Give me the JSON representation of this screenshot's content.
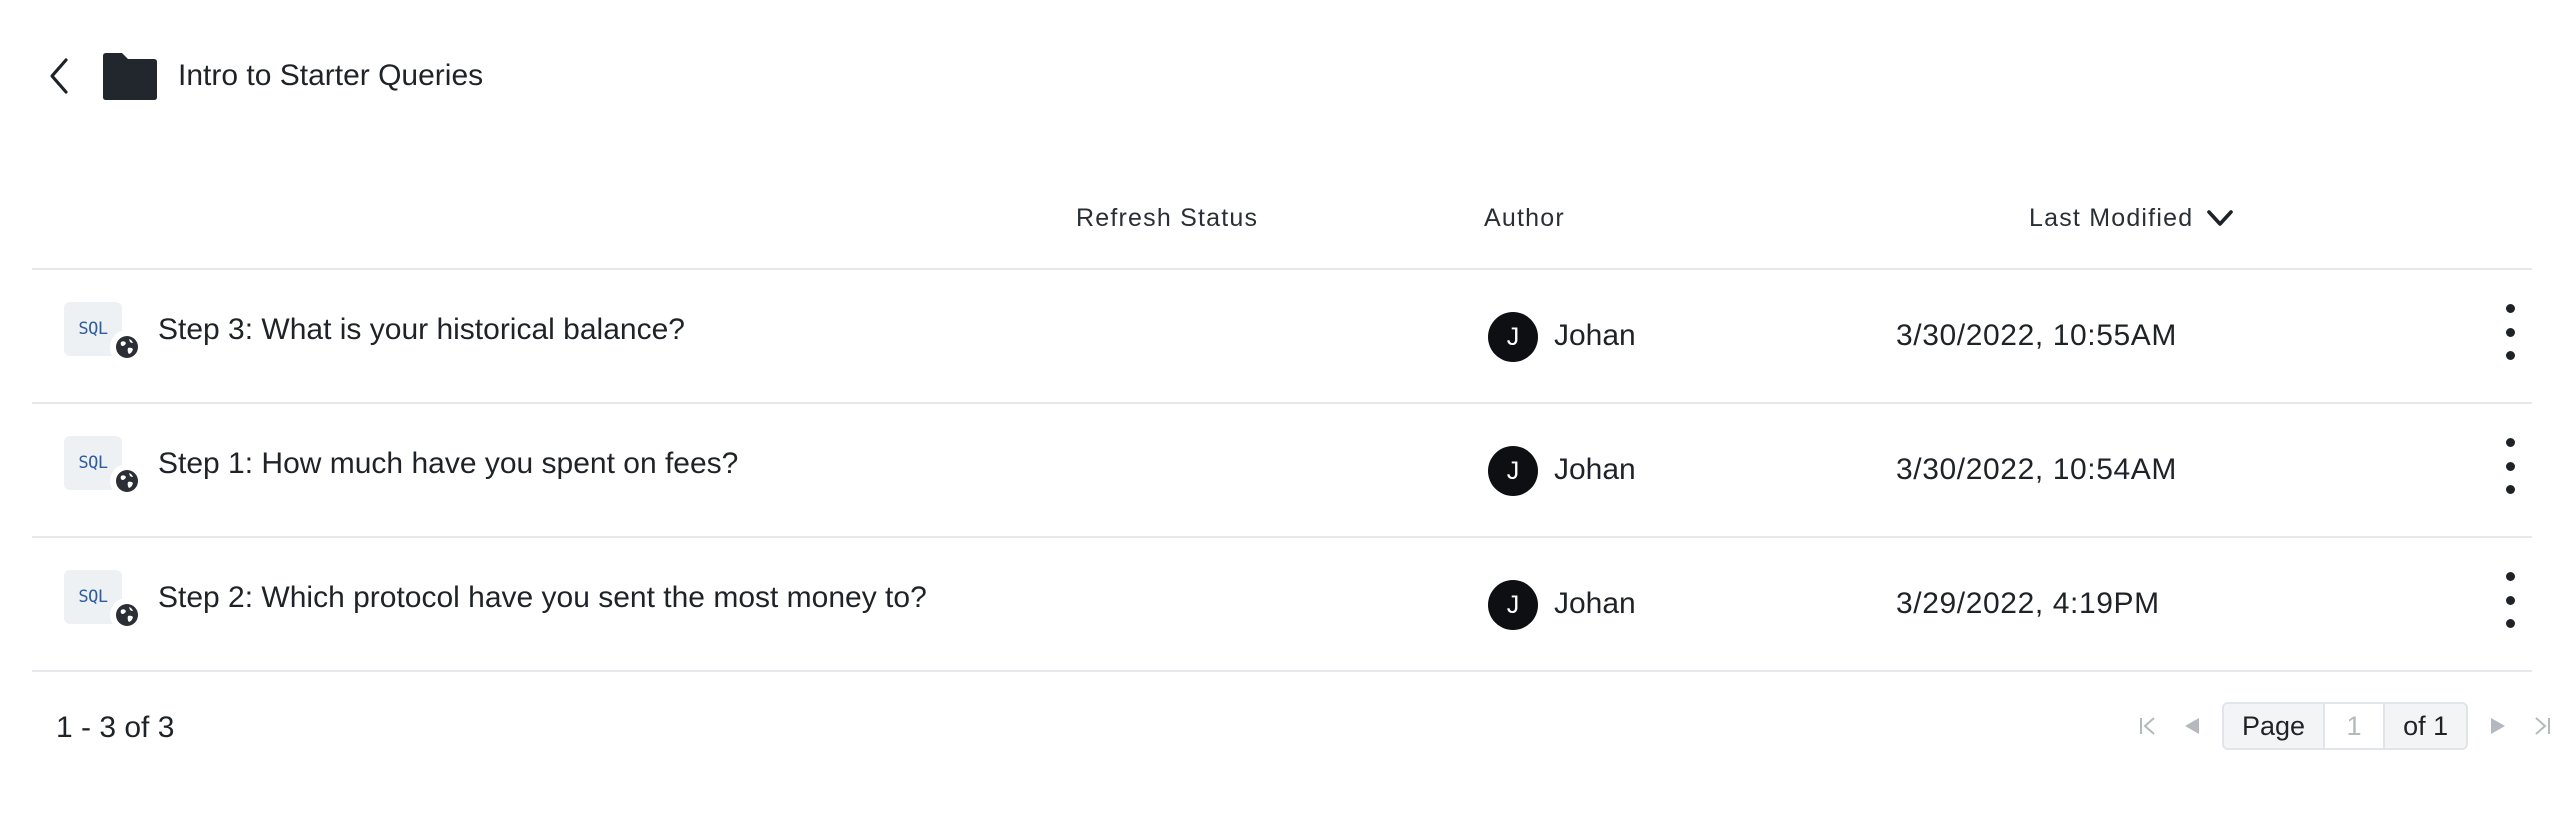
{
  "header": {
    "back_icon": "chevron-left-icon",
    "folder_icon": "folder-icon",
    "title": "Intro to Starter Queries"
  },
  "table": {
    "columns": {
      "refresh_status": "Refresh Status",
      "author": "Author",
      "last_modified": "Last Modified",
      "sort_icon": "chevron-down-icon"
    },
    "rows": [
      {
        "badge": "SQL",
        "name": "Step 3: What is your historical balance?",
        "author_initial": "J",
        "author": "Johan",
        "modified": "3/30/2022, 10:55AM"
      },
      {
        "badge": "SQL",
        "name": "Step 1: How much have you spent on fees?",
        "author_initial": "J",
        "author": "Johan",
        "modified": "3/30/2022, 10:54AM"
      },
      {
        "badge": "SQL",
        "name": "Step 2: Which protocol have you sent the most money to?",
        "author_initial": "J",
        "author": "Johan",
        "modified": "3/29/2022, 4:19PM"
      }
    ]
  },
  "footer": {
    "range": "1 - 3 of 3",
    "page_label": "Page",
    "page_input": "1",
    "page_of": "of 1"
  },
  "colors": {
    "text": "#1f2328",
    "divider": "#e6e8eb",
    "avatar_bg": "#0d0f12",
    "sql_text": "#2d5d9f",
    "disabled": "#b4b9bf"
  }
}
